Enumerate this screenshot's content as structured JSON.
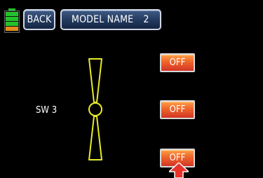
{
  "header": {
    "back_label": "BACK",
    "model_label": "MODEL NAME",
    "model_number": "2"
  },
  "battery": {
    "icon": "battery-icon",
    "fill_fraction": 0.75,
    "colors": {
      "ok": "#25c12c",
      "low": "#e58a1c"
    }
  },
  "switch": {
    "label": "SW 3",
    "positions": [
      {
        "label": "OFF"
      },
      {
        "label": "OFF"
      },
      {
        "label": "OFF"
      }
    ]
  },
  "colors": {
    "background": "#000000",
    "switch_outline": "#e8ea2a",
    "button_orange": "#f06a2c",
    "header_blue": "#22395d",
    "pointer_red": "#e8332b"
  },
  "icons": [
    "battery-icon",
    "three-position-switch-icon",
    "pointer-arrow-icon"
  ]
}
